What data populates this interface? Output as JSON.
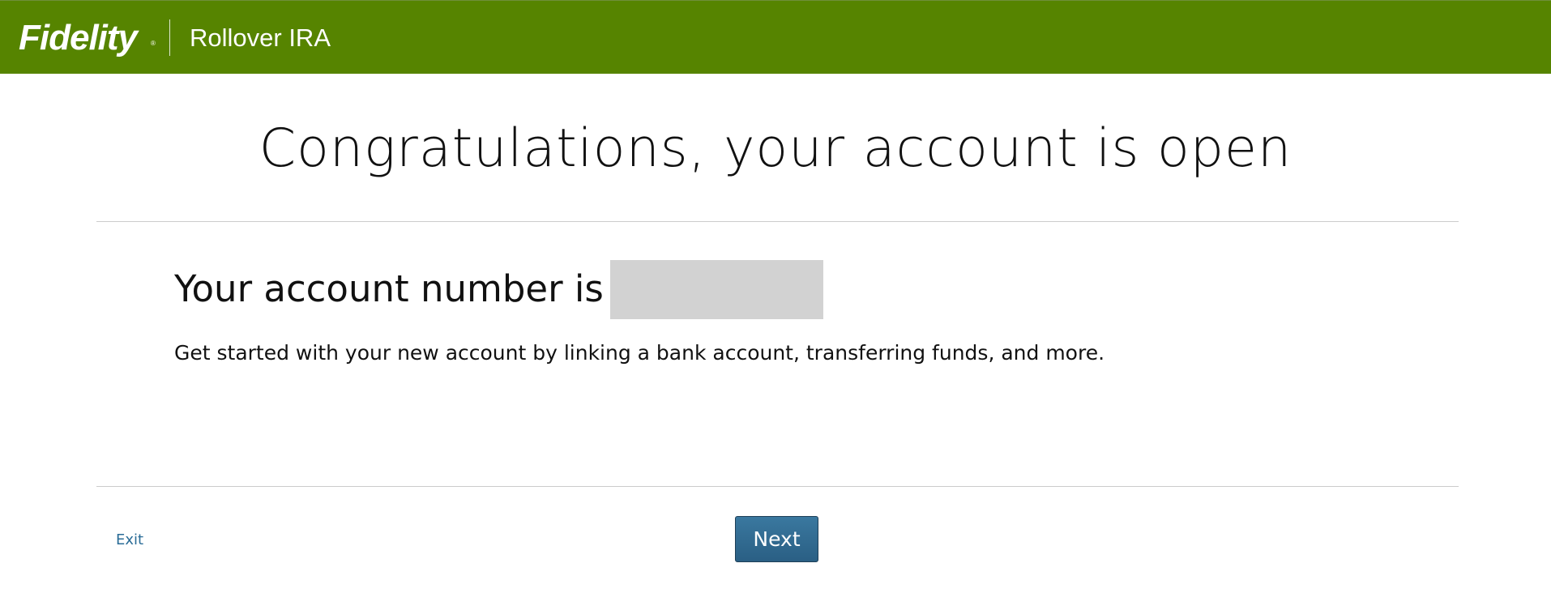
{
  "header": {
    "brand": "Fidelity",
    "brand_mark": "®",
    "product": "Rollover IRA",
    "background_color": "#568400"
  },
  "main": {
    "headline": "Congratulations, your account is open",
    "account_label": "Your account number is",
    "account_number_redacted": true,
    "description": "Get started with your new account by linking a bank account, transferring funds, and more."
  },
  "footer": {
    "exit_label": "Exit",
    "next_label": "Next"
  },
  "colors": {
    "link": "#2a6c97",
    "button": "#2f6a90",
    "redaction": "#d2d2d2"
  }
}
